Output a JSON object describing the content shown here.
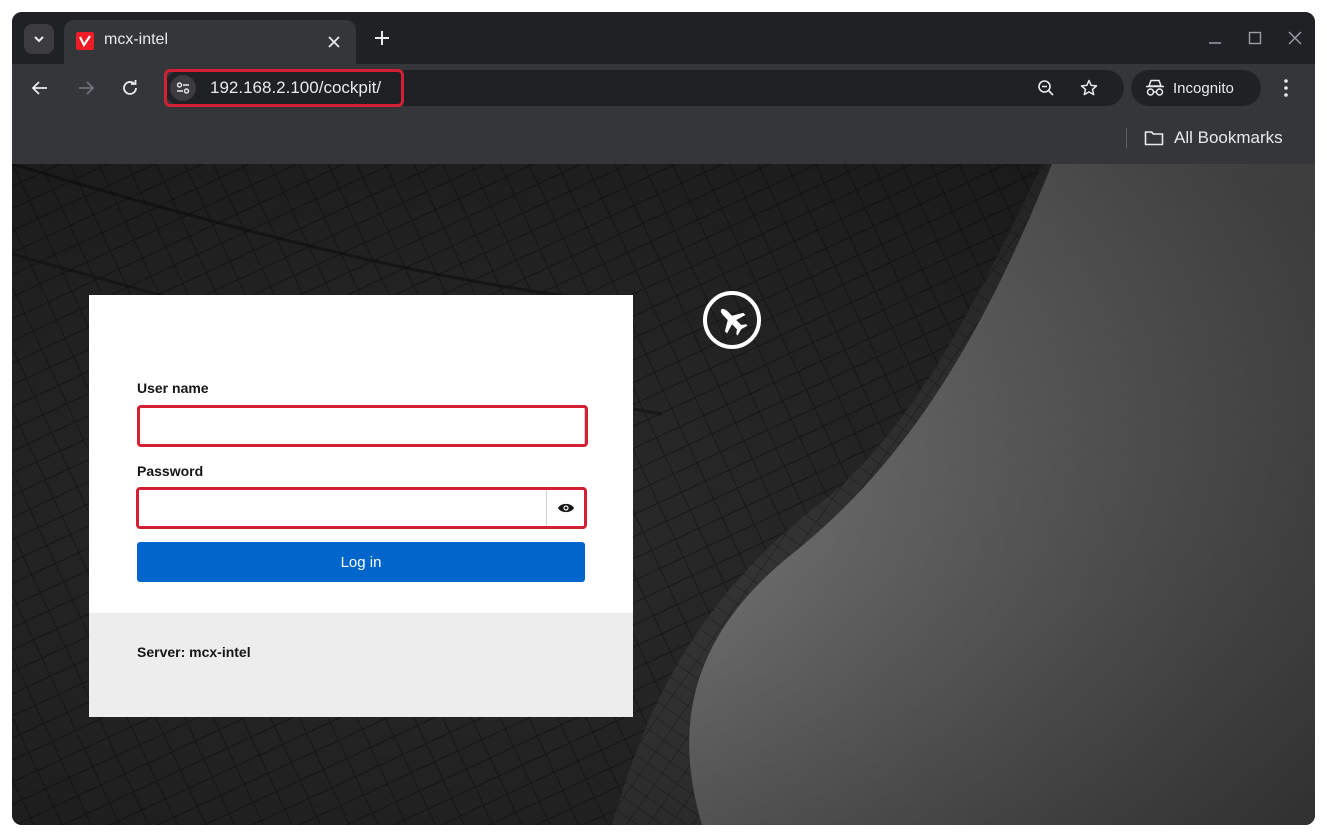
{
  "browser": {
    "tab": {
      "title": "mcx-intel",
      "favicon": "cockpit-favicon"
    },
    "new_tab_label": "+",
    "address_bar": {
      "url": "192.168.2.100/cockpit/"
    },
    "profile": {
      "label": "Incognito"
    },
    "bookmarks": {
      "all_bookmarks_label": "All Bookmarks"
    }
  },
  "login": {
    "username_label": "User name",
    "username_value": "",
    "password_label": "Password",
    "password_value": "",
    "login_button_label": "Log in",
    "server_text": "Server: mcx-intel"
  },
  "colors": {
    "accent": "#0066cc",
    "highlight": "#d32034",
    "favicon": "#ee1c25"
  }
}
